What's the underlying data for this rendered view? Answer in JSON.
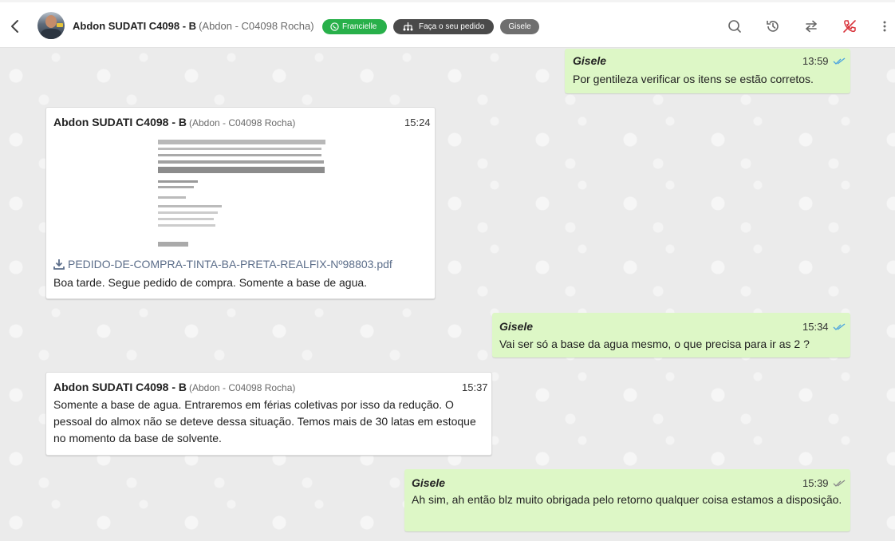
{
  "header": {
    "contact_name": "Abdon SUDATI C4098 - B",
    "contact_sub": "(Abdon - C04098 Rocha)",
    "tags": {
      "agent": "Francielle",
      "order": "Faça o seu pedido",
      "user": "Gisele"
    },
    "icons": [
      "back-icon",
      "search-icon",
      "history-icon",
      "transfer-icon",
      "end-call-icon",
      "more-vert-icon"
    ],
    "colors": {
      "tag_green": "#28b04a",
      "tag_dark": "#4a4a4a",
      "tag_gray": "#6f6f6f",
      "end_call": "#d9363e"
    }
  },
  "messages": [
    {
      "direction": "out",
      "sender": "Gisele",
      "time": "13:59",
      "status": "read",
      "text": "Por gentileza verificar os itens se estão corretos."
    },
    {
      "direction": "in",
      "sender": "Abdon SUDATI C4098 - B",
      "sender_sub": "(Abdon - C04098 Rocha)",
      "time": "15:24",
      "attachment": "PEDIDO-DE-COMPRA-TINTA-BA-PRETA-REALFIX-Nº98803.pdf",
      "text": "Boa tarde. Segue pedido de compra. Somente a base de agua."
    },
    {
      "direction": "out",
      "sender": "Gisele",
      "time": "15:34",
      "status": "read",
      "text": "Vai ser só a base da agua mesmo, o que precisa para ir as 2 ?"
    },
    {
      "direction": "in",
      "sender": "Abdon SUDATI C4098 - B",
      "sender_sub": "(Abdon - C04098 Rocha)",
      "time": "15:37",
      "text": "Somente a base de agua. Entraremos em férias coletivas por isso da redução. O pessoal do almox não se deteve dessa situação. Temos mais de 30 latas em estoque no momento da base de solvente."
    },
    {
      "direction": "out",
      "sender": "Gisele",
      "time": "15:39",
      "status": "delivered",
      "text": "Ah sim, ah então blz muito obrigada pelo retorno qualquer coisa estamos a disposição."
    }
  ],
  "colors": {
    "outgoing_bubble": "#ddf7c6",
    "incoming_bubble": "#ffffff",
    "read_ticks": "#4aa3df",
    "delivered_ticks": "#8a8a8a"
  }
}
